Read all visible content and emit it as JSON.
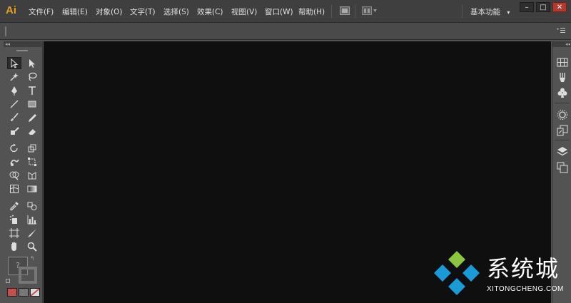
{
  "app": {
    "logo": "Ai"
  },
  "menu": [
    {
      "id": "file",
      "label": "文件(F)"
    },
    {
      "id": "edit",
      "label": "编辑(E)"
    },
    {
      "id": "object",
      "label": "对象(O)"
    },
    {
      "id": "type",
      "label": "文字(T)"
    },
    {
      "id": "select",
      "label": "选择(S)"
    },
    {
      "id": "effect",
      "label": "效果(C)"
    },
    {
      "id": "view",
      "label": "视图(V)"
    },
    {
      "id": "window",
      "label": "窗口(W)"
    },
    {
      "id": "help",
      "label": "帮助(H)"
    }
  ],
  "workspace": {
    "label": "基本功能",
    "caret": "▾"
  },
  "window_controls": {
    "minimize": "–",
    "maximize": "□",
    "close": "✕"
  },
  "panel_collapse": {
    "left": "◂◂",
    "right": "◂◂"
  },
  "toolbox": {
    "swatches": {
      "fill": "#c84e4e",
      "stroke": "#777777",
      "none": "#c84e4e"
    },
    "fill_stroke_placeholder": "?"
  },
  "watermark": {
    "chinese": "系统城",
    "english": "XITONGCHENG.COM",
    "colors": {
      "green": "#8cc63f",
      "blue": "#1a9ad6"
    }
  },
  "colors": {
    "logo": "#e6a021",
    "canvas": "#0f0f0f",
    "chrome": "#535353"
  }
}
